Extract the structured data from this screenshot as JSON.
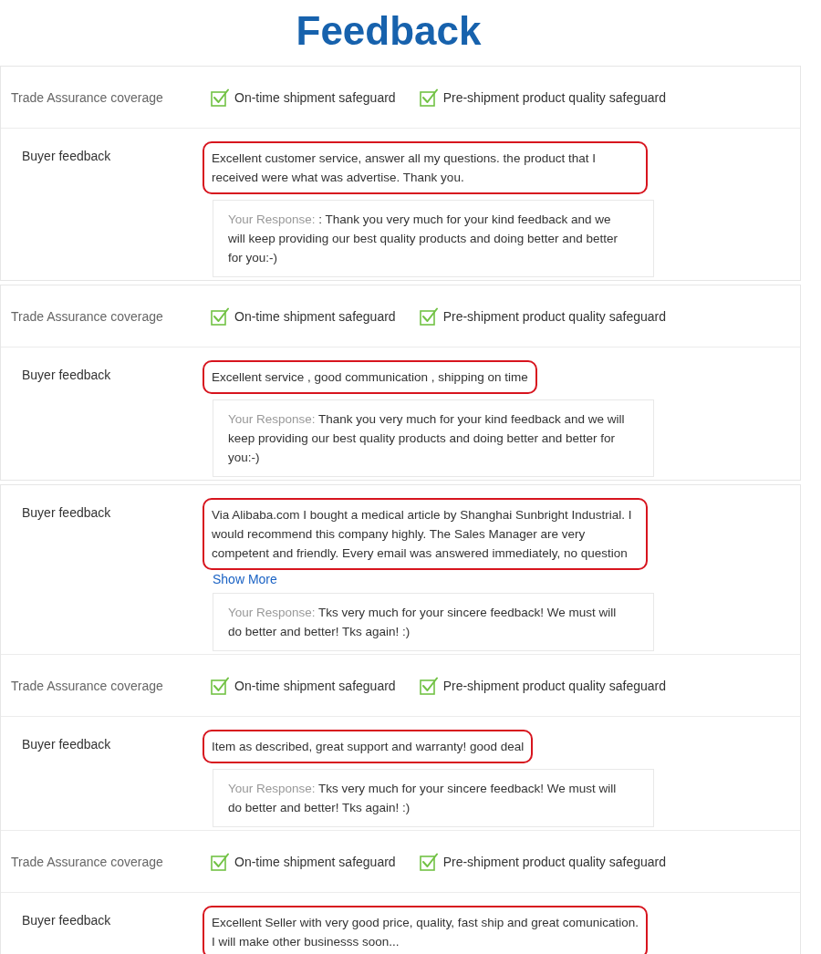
{
  "title": "Feedback",
  "panels": [
    {
      "rows": [
        {
          "kind": "coverage",
          "label": "Trade Assurance coverage",
          "items": [
            {
              "label": "On-time shipment safeguard",
              "checked": true
            },
            {
              "label": "Pre-shipment product quality safeguard",
              "checked": true
            }
          ]
        },
        {
          "kind": "feedback",
          "label": "Buyer feedback",
          "text": "Excellent customer service, answer all my questions. the product that I received were what was advertise. Thank you.",
          "highlighted": true,
          "response": {
            "label": "Your Response:",
            "text": ": Thank you very much for your kind feedback and we will keep providing our best quality products and doing better and better for you:-)"
          }
        }
      ]
    },
    {
      "rows": [
        {
          "kind": "coverage",
          "label": "Trade Assurance coverage",
          "items": [
            {
              "label": "On-time shipment safeguard",
              "checked": true
            },
            {
              "label": "Pre-shipment product quality safeguard",
              "checked": true
            }
          ]
        },
        {
          "kind": "feedback",
          "label": "Buyer feedback",
          "text": "Excellent service , good communication , shipping on time",
          "highlighted": true,
          "response": {
            "label": "Your Response:",
            "text": "Thank you very much for your kind feedback and we will keep providing our best quality products and doing better and better for you:-)"
          }
        }
      ]
    },
    {
      "rows": [
        {
          "kind": "feedback",
          "label": "Buyer feedback",
          "text": "Via Alibaba.com I bought a medical article by Shanghai Sunbright Industrial. I would recommend this company highly. The Sales Manager are very competent and friendly. Every email was answered immediately, no question",
          "highlighted": true,
          "link": "Show More",
          "response": {
            "label": "Your Response:",
            "text": "Tks very much for your sincere feedback! We must will do better and better! Tks again! :)"
          }
        },
        {
          "kind": "coverage",
          "label": "Trade Assurance coverage",
          "items": [
            {
              "label": "On-time shipment safeguard",
              "checked": true
            },
            {
              "label": "Pre-shipment product quality safeguard",
              "checked": true
            }
          ]
        },
        {
          "kind": "feedback",
          "label": "Buyer feedback",
          "text": "Item as described, great support and warranty! good deal",
          "highlighted": true,
          "response": {
            "label": "Your Response:",
            "text": "Tks very much for your sincere feedback! We must will do better and better! Tks again! :)"
          }
        },
        {
          "kind": "coverage",
          "label": "Trade Assurance coverage",
          "items": [
            {
              "label": "On-time shipment safeguard",
              "checked": true
            },
            {
              "label": "Pre-shipment product quality safeguard",
              "checked": true
            }
          ]
        },
        {
          "kind": "feedback",
          "label": "Buyer feedback",
          "text": "Excellent Seller with very good price, quality, fast ship and great comunication. I will make other businesss soon...",
          "highlighted": true
        }
      ]
    }
  ]
}
